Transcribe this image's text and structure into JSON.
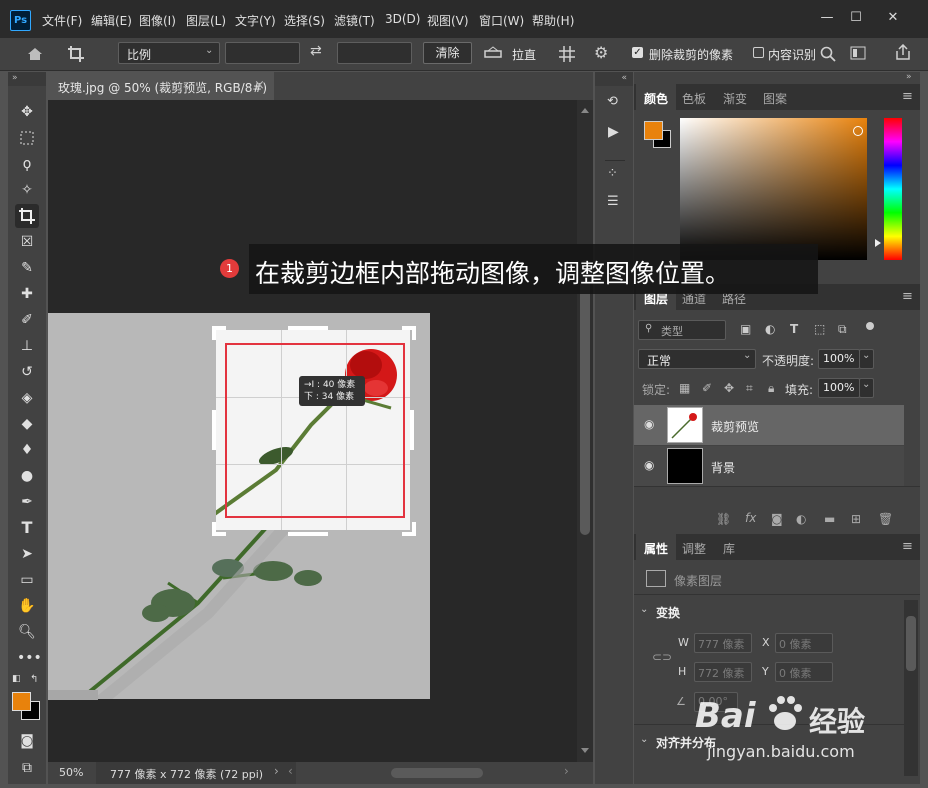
{
  "app": {
    "logo": "Ps"
  },
  "menu": [
    "文件(F)",
    "编辑(E)",
    "图像(I)",
    "图层(L)",
    "文字(Y)",
    "选择(S)",
    "滤镜(T)",
    "3D(D)",
    "视图(V)",
    "窗口(W)",
    "帮助(H)"
  ],
  "window_controls": {
    "minimize": "—",
    "maximize": "☐",
    "close": "✕"
  },
  "options": {
    "ratio_select": "比例",
    "clear_button": "清除",
    "straighten_label": "拉直",
    "delete_cropped_label": "删除裁剪的像素",
    "content_aware_label": "内容识别",
    "delete_cropped_checked": true,
    "content_aware_checked": false
  },
  "document": {
    "tab_title": "玫瑰.jpg @ 50% (裁剪预览, RGB/8#)",
    "tab_close": "×",
    "zoom": "50%",
    "size_info": "777 像素 x 772 像素 (72 ppi)"
  },
  "crop_tooltip": {
    "line1": "→I : 40 像素",
    "line2": "下 : 34 像素"
  },
  "annotation": {
    "number": "1",
    "text": "在裁剪边框内部拖动图像，调整图像位置。"
  },
  "color_panel": {
    "tabs": [
      "颜色",
      "色板",
      "渐变",
      "图案"
    ],
    "active_tab": "颜色",
    "foreground": "#e8820c",
    "background": "#000000"
  },
  "layers_panel": {
    "tabs": [
      "图层",
      "通道",
      "路径"
    ],
    "active_tab": "图层",
    "filter_label": "类型",
    "blend_mode": "正常",
    "opacity_label": "不透明度:",
    "opacity_value": "100%",
    "lock_label": "锁定:",
    "fill_label": "填充:",
    "fill_value": "100%",
    "layers": [
      {
        "name": "裁剪预览",
        "selected": true
      },
      {
        "name": "背景",
        "selected": false
      }
    ]
  },
  "properties_panel": {
    "tabs": [
      "属性",
      "调整",
      "库"
    ],
    "active_tab": "属性",
    "type_label": "像素图层",
    "transform_heading": "变换",
    "w_label": "W",
    "w_value": "777 像素",
    "h_label": "H",
    "h_value": "772 像素",
    "x_label": "X",
    "x_value": "0 像素",
    "y_label": "Y",
    "y_value": "0 像素",
    "angle_value": "0.00°",
    "align_heading": "对齐并分布"
  },
  "watermark": {
    "brand": "Bai",
    "brand2": "经验",
    "url": "jingyan.baidu.com"
  }
}
